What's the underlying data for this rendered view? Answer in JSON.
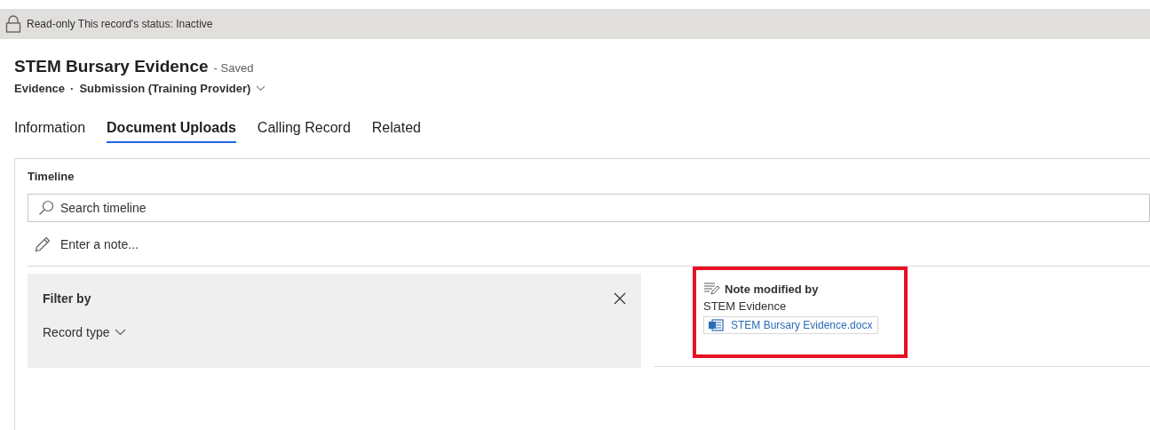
{
  "notice": {
    "label": "Read-only",
    "text": "This record's status: Inactive"
  },
  "header": {
    "title": "STEM Bursary Evidence",
    "save_state": "- Saved",
    "entity": "Evidence",
    "separator": "·",
    "form": "Submission (Training Provider)"
  },
  "tabs": [
    {
      "label": "Information",
      "selected": false
    },
    {
      "label": "Document Uploads",
      "selected": true
    },
    {
      "label": "Calling Record",
      "selected": false
    },
    {
      "label": "Related",
      "selected": false
    }
  ],
  "timeline": {
    "title": "Timeline",
    "search": {
      "placeholder": "Search timeline"
    },
    "note": {
      "placeholder": "Enter a note..."
    },
    "filter": {
      "title": "Filter by",
      "option": "Record type"
    },
    "items": [
      {
        "title": "Note modified by",
        "author": "STEM Evidence",
        "attachment": "STEM Bursary Evidence.docx",
        "highlighted": true
      }
    ]
  }
}
